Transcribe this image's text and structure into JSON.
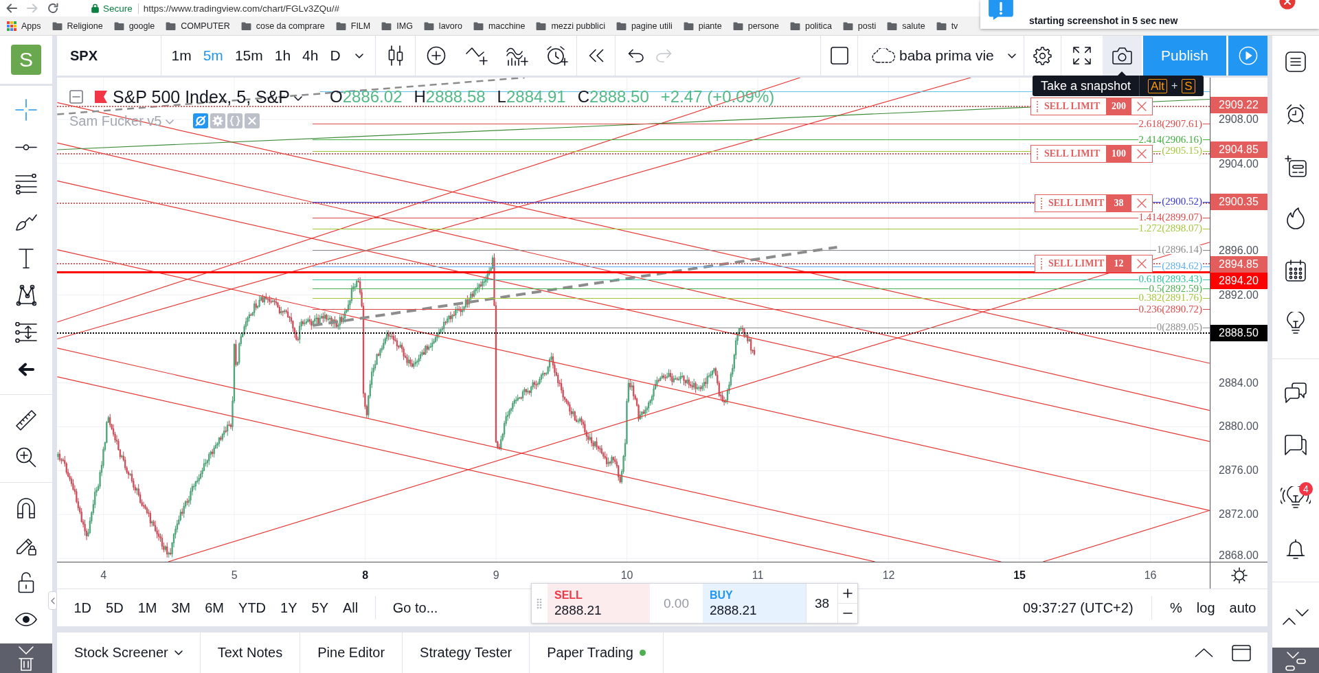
{
  "browser": {
    "secure_label": "Secure",
    "url": "https://www.tradingview.com/chart/FGLv3ZQu/#",
    "bookmarks": [
      {
        "label": "Apps",
        "kind": "apps"
      },
      {
        "label": "Religione",
        "kind": "folder"
      },
      {
        "label": "google",
        "kind": "folder"
      },
      {
        "label": "COMPUTER",
        "kind": "folder"
      },
      {
        "label": "cose da comprare",
        "kind": "folder"
      },
      {
        "label": "FILM",
        "kind": "folder"
      },
      {
        "label": "IMG",
        "kind": "folder"
      },
      {
        "label": "lavoro",
        "kind": "folder"
      },
      {
        "label": "macchine",
        "kind": "folder"
      },
      {
        "label": "mezzi pubblici",
        "kind": "folder"
      },
      {
        "label": "pagine utili",
        "kind": "folder"
      },
      {
        "label": "piante",
        "kind": "folder"
      },
      {
        "label": "persone",
        "kind": "folder"
      },
      {
        "label": "politica",
        "kind": "folder"
      },
      {
        "label": "posti",
        "kind": "folder"
      },
      {
        "label": "salute",
        "kind": "folder"
      },
      {
        "label": "tv",
        "kind": "folder"
      }
    ]
  },
  "notification": {
    "text": "starting screenshot in 5 sec new"
  },
  "avatar": {
    "letter": "S"
  },
  "toolbar": {
    "symbol": "SPX",
    "intervals": [
      {
        "label": "1m",
        "selected": false
      },
      {
        "label": "5m",
        "selected": true
      },
      {
        "label": "15m",
        "selected": false
      },
      {
        "label": "1h",
        "selected": false
      },
      {
        "label": "4h",
        "selected": false
      },
      {
        "label": "D",
        "selected": false
      }
    ],
    "history": [
      {
        "kind": "undo",
        "disabled": false
      },
      {
        "kind": "redo",
        "disabled": true
      }
    ],
    "layout_name": "baba prima vie",
    "snapshot": {
      "hovered": true
    },
    "publish": "Publish"
  },
  "tooltip": {
    "text": "Take a snapshot",
    "keys": [
      "Alt",
      "S"
    ],
    "joiner": "+"
  },
  "legend": {
    "title": "S&P 500 Index, 5, S&P",
    "ohlc": [
      {
        "key": "O",
        "value": "2886.02"
      },
      {
        "key": "H",
        "value": "2888.58"
      },
      {
        "key": "L",
        "value": "2884.91"
      },
      {
        "key": "C",
        "value": "2888.50"
      }
    ],
    "change": "+2.47 (+0.09%)",
    "indicator": {
      "name": "Sam Fucker v5",
      "hidden": true
    }
  },
  "orders": [
    {
      "type": "SELL LIMIT",
      "quantity": "200"
    },
    {
      "type": "SELL LIMIT",
      "quantity": "100"
    },
    {
      "type": "SELL LIMIT",
      "quantity": "38"
    },
    {
      "type": "SELL LIMIT",
      "quantity": "12"
    }
  ],
  "fib_levels": [
    {
      "label": "2.618(2907.61)",
      "color": "#e04848"
    },
    {
      "label": "2.414(2906.16)",
      "color": "#3fae3f"
    },
    {
      "label": "(2905.15)",
      "color": "#a2c73b"
    },
    {
      "label": "(2900.52)",
      "color": "#3434d6"
    },
    {
      "label": "1.414(2899.07)",
      "color": "#e04848"
    },
    {
      "label": "1.272(2898.07)",
      "color": "#a2c73b"
    },
    {
      "label": "1(2896.14)",
      "color": "#8a8a8a"
    },
    {
      "label": "(2894.62)",
      "color": "#5fb0f0"
    },
    {
      "label": "0.618(2893.43)",
      "color": "#2ec4a0"
    },
    {
      "label": "0.5(2892.59)",
      "color": "#4caf50"
    },
    {
      "label": "0.382(2891.76)",
      "color": "#a2c73b"
    },
    {
      "label": "0.236(2890.72)",
      "color": "#e04848"
    },
    {
      "label": "0(2889.05)",
      "color": "#8a8a8a"
    }
  ],
  "price_axis": {
    "ticks": [
      "2908.00",
      "2904.00",
      "2896.00",
      "2892.00",
      "2884.00",
      "2880.00",
      "2876.00",
      "2872.00",
      "2868.00"
    ],
    "markers": [
      {
        "value": "2909.22",
        "kind": "order",
        "color": "#e35d5d"
      },
      {
        "value": "2904.85",
        "kind": "order",
        "color": "#e35d5d"
      },
      {
        "value": "2900.35",
        "kind": "order",
        "color": "#e35d5d"
      },
      {
        "value": "2894.85",
        "kind": "order",
        "color": "#e35d5d"
      },
      {
        "value": "2894.20",
        "kind": "position",
        "color": "#ff0000"
      },
      {
        "value": "2888.50",
        "kind": "last",
        "color": "#000000"
      }
    ]
  },
  "time_axis": {
    "labels": [
      {
        "text": "4",
        "week_start": false
      },
      {
        "text": "5",
        "week_start": false
      },
      {
        "text": "8",
        "week_start": true
      },
      {
        "text": "9",
        "week_start": false
      },
      {
        "text": "10",
        "week_start": false
      },
      {
        "text": "11",
        "week_start": false
      },
      {
        "text": "12",
        "week_start": false
      },
      {
        "text": "15",
        "week_start": true
      },
      {
        "text": "16",
        "week_start": false
      }
    ]
  },
  "bottom_toolbar": {
    "ranges": [
      "1D",
      "5D",
      "1M",
      "3M",
      "6M",
      "YTD",
      "1Y",
      "5Y",
      "All"
    ],
    "goto": "Go to...",
    "clock": "09:37:27 (UTC+2)",
    "scale_options": [
      "%",
      "log",
      "auto"
    ]
  },
  "trade_widget": {
    "sell": {
      "label": "SELL",
      "price": "2888.21"
    },
    "spread": "0.00",
    "buy": {
      "label": "BUY",
      "price": "2888.21"
    },
    "quantity": "38"
  },
  "bottom_tabs": [
    {
      "label": "Stock Screener",
      "kind": "dropdown"
    },
    {
      "label": "Text Notes",
      "kind": "plain"
    },
    {
      "label": "Pine Editor",
      "kind": "plain"
    },
    {
      "label": "Strategy Tester",
      "kind": "plain"
    },
    {
      "label": "Paper Trading",
      "kind": "connected"
    }
  ],
  "right_sidebar": {
    "badge": "4"
  }
}
